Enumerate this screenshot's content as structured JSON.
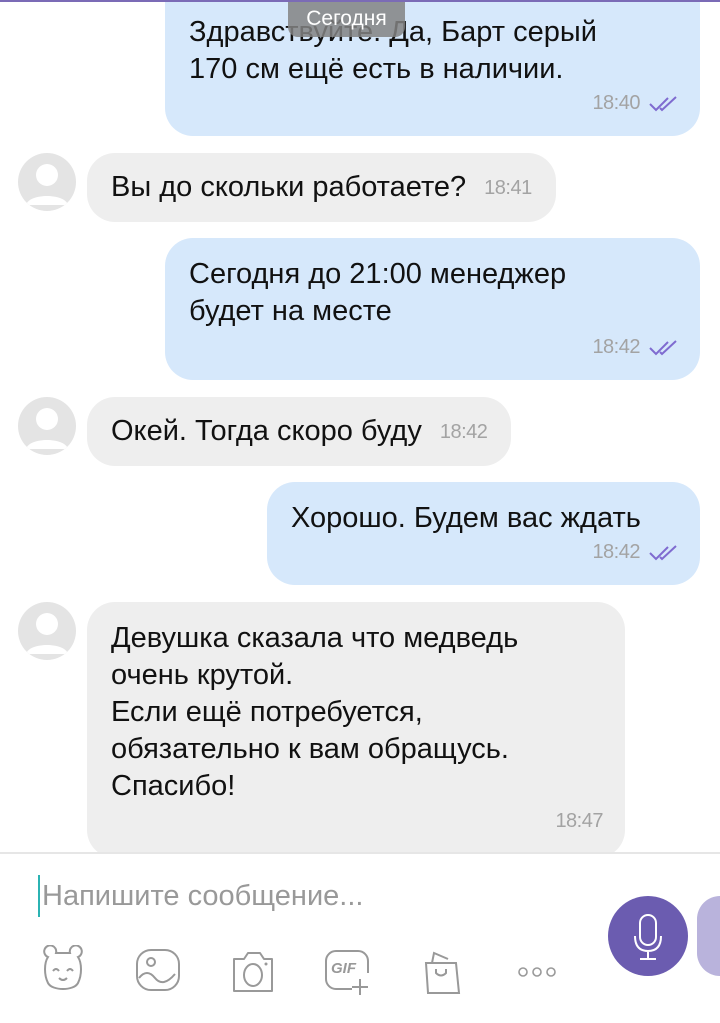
{
  "date_chip": "Сегодня",
  "messages": [
    {
      "dir": "out",
      "lines": [
        "Здравствуйте.  Да, Барт серый",
        "170 см ещё есть в наличии."
      ],
      "time": "18:40"
    },
    {
      "dir": "in",
      "text": "Вы до скольки работаете?",
      "time": "18:41"
    },
    {
      "dir": "out",
      "lines": [
        "Сегодня до 21:00 менеджер",
        "будет на месте"
      ],
      "time": "18:42"
    },
    {
      "dir": "in",
      "text": "Окей. Тогда скоро буду",
      "time": "18:42"
    },
    {
      "dir": "out",
      "lines": [
        "Хорошо. Будем вас ждать"
      ],
      "time": "18:42"
    },
    {
      "dir": "in",
      "lines": [
        "Девушка сказала что медведь",
        "очень крутой.",
        "Если ещё потребуется,",
        "обязательно к вам обращусь.",
        "Спасибо!"
      ],
      "time": "18:47"
    }
  ],
  "composer": {
    "placeholder": "Напишите сообщение...",
    "gif_label": "GIF"
  },
  "colors": {
    "accent": "#6b5cb0",
    "outgoing": "#d6e8fb",
    "incoming": "#eeeeee",
    "read_check": "#7f6bd0"
  }
}
